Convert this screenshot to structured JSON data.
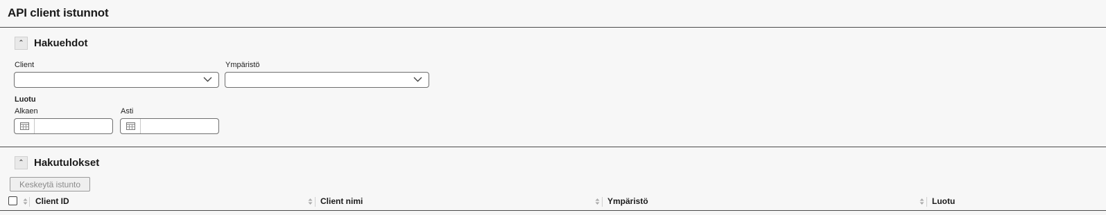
{
  "page": {
    "title": "API client istunnot"
  },
  "search": {
    "title": "Hakuehdot",
    "client_label": "Client",
    "client_value": "",
    "env_label": "Ympäristö",
    "env_value": "",
    "created_label": "Luotu",
    "from_label": "Alkaen",
    "from_value": "",
    "to_label": "Asti",
    "to_value": ""
  },
  "results": {
    "title": "Hakutulokset",
    "suspend_button": "Keskeytä istunto",
    "columns": [
      "Client ID",
      "Client nimi",
      "Ympäristö",
      "Luotu"
    ]
  },
  "icons": {
    "collapse": "chevron-up-icon",
    "dropdown": "chevron-down-icon",
    "calendar": "calendar-icon",
    "sort": "sort-icon"
  }
}
